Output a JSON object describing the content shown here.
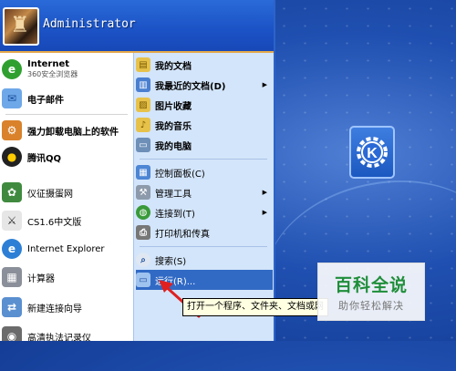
{
  "user": {
    "name": "Administrator"
  },
  "pinned": [
    {
      "label": "Internet",
      "sublabel": "360安全浏览器",
      "icon": "browser-360-icon"
    },
    {
      "label": "电子邮件",
      "icon": "email-icon"
    }
  ],
  "recent": [
    {
      "label": "强力卸载电脑上的软件",
      "icon": "uninstall-icon"
    },
    {
      "label": "腾讯QQ",
      "icon": "qq-penguin-icon"
    },
    {
      "label": "仪征摄蛋网",
      "icon": "game-icon"
    },
    {
      "label": "CS1.6中文版",
      "icon": "counter-strike-icon"
    },
    {
      "label": "Internet Explorer",
      "icon": "internet-explorer-icon"
    },
    {
      "label": "计算器",
      "icon": "calculator-icon"
    },
    {
      "label": "新建连接向导",
      "icon": "connection-wizard-icon"
    },
    {
      "label": "高清执法记录仪",
      "icon": "camera-icon"
    }
  ],
  "places": [
    {
      "label": "我的文档",
      "icon": "my-documents-icon"
    },
    {
      "label": "我最近的文档(D)",
      "icon": "recent-documents-icon",
      "has_submenu": true
    },
    {
      "label": "图片收藏",
      "icon": "my-pictures-icon"
    },
    {
      "label": "我的音乐",
      "icon": "my-music-icon"
    },
    {
      "label": "我的电脑",
      "icon": "my-computer-icon"
    }
  ],
  "system": [
    {
      "label": "控制面板(C)",
      "icon": "control-panel-icon"
    },
    {
      "label": "管理工具",
      "icon": "admin-tools-icon",
      "has_submenu": true
    },
    {
      "label": "连接到(T)",
      "icon": "connect-to-icon",
      "has_submenu": true
    },
    {
      "label": "打印机和传真",
      "icon": "printer-icon"
    }
  ],
  "help": [
    {
      "label": "搜索(S)",
      "icon": "search-icon"
    },
    {
      "label": "运行(R)...",
      "icon": "run-icon",
      "selected": true
    }
  ],
  "tooltip": "打开一个程序、文件夹、文档或网",
  "watermark": {
    "main": "百科全说",
    "sub": "助你轻松解决"
  },
  "colors": {
    "header": "#1b52c5",
    "right_panel": "#d3e5fa",
    "selection": "#316ac5",
    "arrow": "#e02020",
    "watermark_green": "#1f8e3a"
  }
}
